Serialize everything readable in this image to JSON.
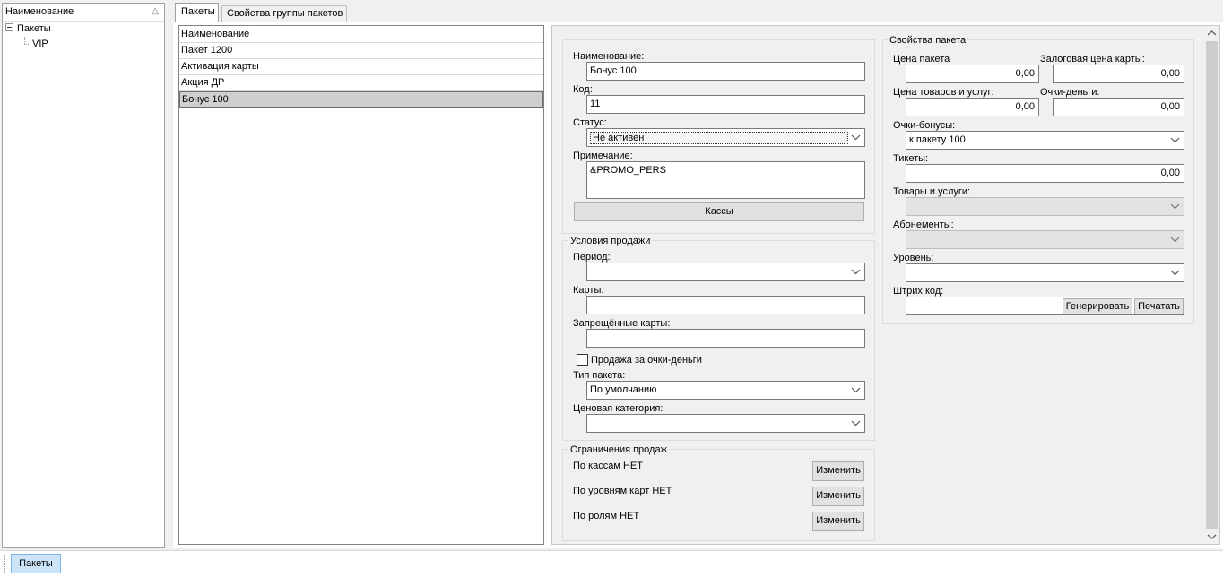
{
  "tree": {
    "header": "Наименование",
    "root": "Пакеты",
    "child": "VIP"
  },
  "tabs": [
    "Пакеты",
    "Свойства группы пакетов"
  ],
  "list": {
    "header": "Наименование",
    "items": [
      "Пакет 1200",
      "Активация карты",
      "Акция ДР",
      "Бонус 100"
    ],
    "selected_index": 3
  },
  "main": {
    "name_label": "Наименование:",
    "name_value": "Бонус 100",
    "code_label": "Код:",
    "code_value": "11",
    "status_label": "Статус:",
    "status_value": "Не активен",
    "note_label": "Примечание:",
    "note_value": "&PROMO_PERS",
    "kassy_button": "Кассы"
  },
  "sale_conditions": {
    "title": "Условия продажи",
    "period_label": "Период:",
    "cards_label": "Карты:",
    "forbidden_cards_label": "Запрещённые карты:",
    "sale_for_points_label": "Продажа за очки-деньги",
    "package_type_label": "Тип пакета:",
    "package_type_value": "По умолчанию",
    "price_category_label": "Ценовая категория:"
  },
  "sale_limits": {
    "title": "Ограничения продаж",
    "items": [
      "По кассам НЕТ",
      "По уровням карт НЕТ",
      "По ролям НЕТ"
    ],
    "change_button": "Изменить"
  },
  "package_props": {
    "title": "Свойства пакета",
    "price_label": "Цена пакета",
    "price_value": "0,00",
    "deposit_label": "Залоговая цена карты:",
    "deposit_value": "0,00",
    "goods_price_label": "Цена товаров и услуг:",
    "goods_price_value": "0,00",
    "points_money_label": "Очки-деньги:",
    "points_money_value": "0,00",
    "bonus_points_label": "Очки-бонусы:",
    "bonus_points_value": "к пакету 100",
    "tickets_label": "Тикеты:",
    "tickets_value": "0,00",
    "goods_label": "Товары и услуги:",
    "subscriptions_label": "Абонементы:",
    "level_label": "Уровень:",
    "barcode_label": "Штрих код:",
    "generate_button": "Генерировать",
    "print_button": "Печатать"
  },
  "bottom_tab": "Пакеты"
}
